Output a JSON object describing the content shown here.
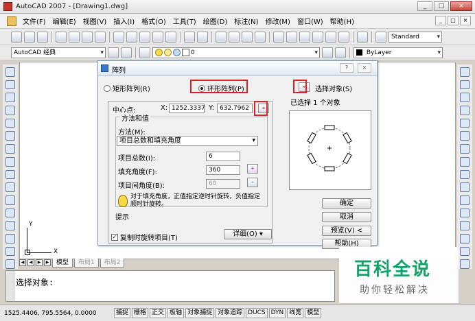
{
  "window": {
    "title": "AutoCAD 2007 - [Drawing1.dwg]",
    "controls": [
      "_",
      "□",
      "×"
    ]
  },
  "menu": {
    "items": [
      "文件(F)",
      "编辑(E)",
      "视图(V)",
      "插入(I)",
      "格式(O)",
      "工具(T)",
      "绘图(D)",
      "标注(N)",
      "修改(M)",
      "窗口(W)",
      "帮助(H)"
    ],
    "mdi_controls": [
      "_",
      "□",
      "×"
    ]
  },
  "toolbar": {
    "text_style": "Standard",
    "workspace": "AutoCAD 经典",
    "layer": "0",
    "color": "ByLayer"
  },
  "dialog": {
    "title": "阵列",
    "title_controls": [
      "?",
      "×"
    ],
    "radio_rect": "矩形阵列(R)",
    "radio_polar": "环形阵列(P)",
    "select_objects_label": "选择对象(S)",
    "selected_count_text": "已选择 1 个对象",
    "center_label": "中心点:",
    "x_label": "X:",
    "x_value": "1252.3337",
    "y_label": "Y:",
    "y_value": "632.7962",
    "method_group_title": "方法和值",
    "method_label": "方法(M):",
    "method_value": "项目总数和填充角度",
    "total_items_label": "项目总数(I):",
    "total_items_value": "6",
    "fill_angle_label": "填充角度(F):",
    "fill_angle_value": "360",
    "item_angle_label": "项目间角度(B):",
    "item_angle_value": "60",
    "tip_text": "对于填充角度，正值指定逆时针旋转，负值指定顺时针旋转。",
    "tip_label": "提示",
    "rotate_items_label": "复制时旋转项目(T)",
    "rotate_items_checked": true,
    "more_button": "详细(O) ▾",
    "ok_button": "确定",
    "cancel_button": "取消",
    "preview_button": "预览(V) <",
    "help_button": "帮助(H)",
    "preview_item_count": 6
  },
  "layout_tabs": [
    "模型",
    "布局1",
    "布局2"
  ],
  "command": {
    "prompt": "选择对象:"
  },
  "status": {
    "coords": "1525.4406, 795.5564, 0.0000",
    "toggles": [
      "捕捉",
      "栅格",
      "正交",
      "极轴",
      "对象捕捉",
      "对象追踪",
      "DUCS",
      "DYN",
      "线宽",
      "模型"
    ]
  },
  "ucs": {
    "x_label": "X",
    "y_label": "Y"
  },
  "watermark": {
    "title": "百科全说",
    "subtitle": "助你轻松解决"
  },
  "colors": {
    "highlight_box": "#e02020",
    "watermark_green": "#13a36a"
  }
}
